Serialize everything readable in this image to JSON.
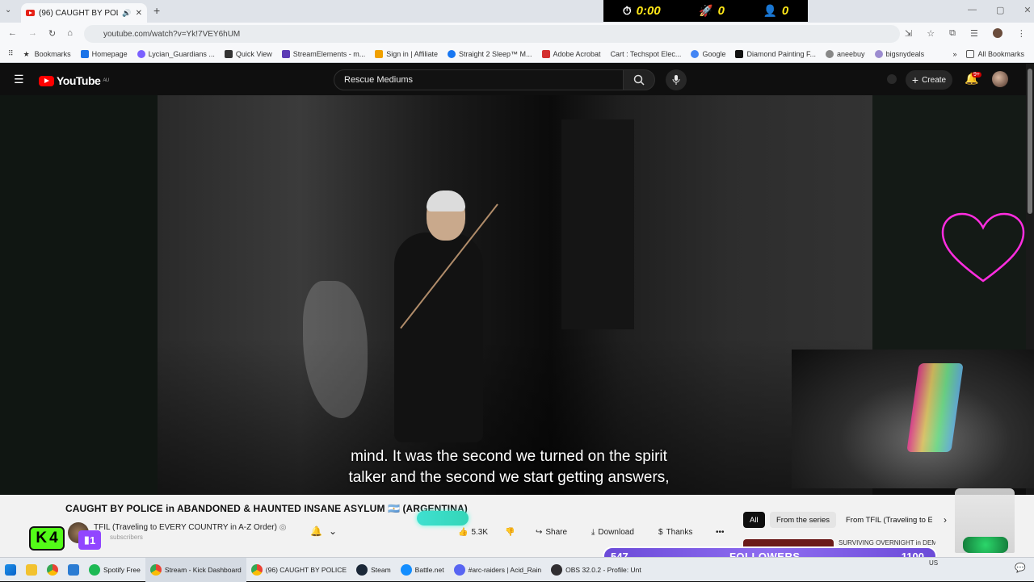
{
  "browser": {
    "tab_title": "(96) CAUGHT BY POLICE in",
    "url": "youtube.com/watch?v=Yk!7VEY6hUM",
    "bookmarks": [
      "Bookmarks",
      "Homepage",
      "Lycian_Guardians ...",
      "Quick View",
      "StreamElements - m...",
      "Sign in | Affiliate",
      "Straight 2 Sleep™ M...",
      "Adobe Acrobat",
      "Cart : Techspot Elec...",
      "Google",
      "Diamond Painting F...",
      "aneebuy",
      "bigsnydeals"
    ],
    "all_bookmarks": "All Bookmarks"
  },
  "stream_stats": {
    "timer": "0:00",
    "boosts": "0",
    "viewers": "0"
  },
  "youtube": {
    "logo": "YouTube",
    "region": "AU",
    "search_value": "Rescue Mediums",
    "create_label": "Create",
    "notif_badge": "9+",
    "subtitle_line1": "mind. It was the second we turned on the spirit",
    "subtitle_line2": "talker and the second we start getting answers,",
    "video_title": "CAUGHT BY POLICE in ABANDONED & HAUNTED INSANE ASYLUM 🇦🇷 (ARGENTINA)",
    "channel": "TFIL (Traveling to EVERY COUNTRY in A-Z Order)",
    "subscribers": "subscribers",
    "likes": "5.3K",
    "share": "Share",
    "download": "Download",
    "thanks": "Thanks",
    "chips": {
      "all": "All",
      "series": "From the series",
      "from": "From TFIL (Traveling to E"
    },
    "next_video": "SURVIVING OVERNIGHT in DEMONIC SCHOOL"
  },
  "overlays": {
    "kick_count": "4",
    "twitch_count": "1",
    "followers_current": "547",
    "followers_label": "FOLLOWERS",
    "followers_goal": "1100"
  },
  "taskbar": [
    "Spotify Free",
    "Stream - Kick Dashboard",
    "(96) CAUGHT BY POLICE",
    "Steam",
    "Battle.net",
    "#arc-raiders | Acid_Rain",
    "OBS 32.0.2 - Profile: Unt"
  ],
  "tray": {
    "lang": "US"
  }
}
